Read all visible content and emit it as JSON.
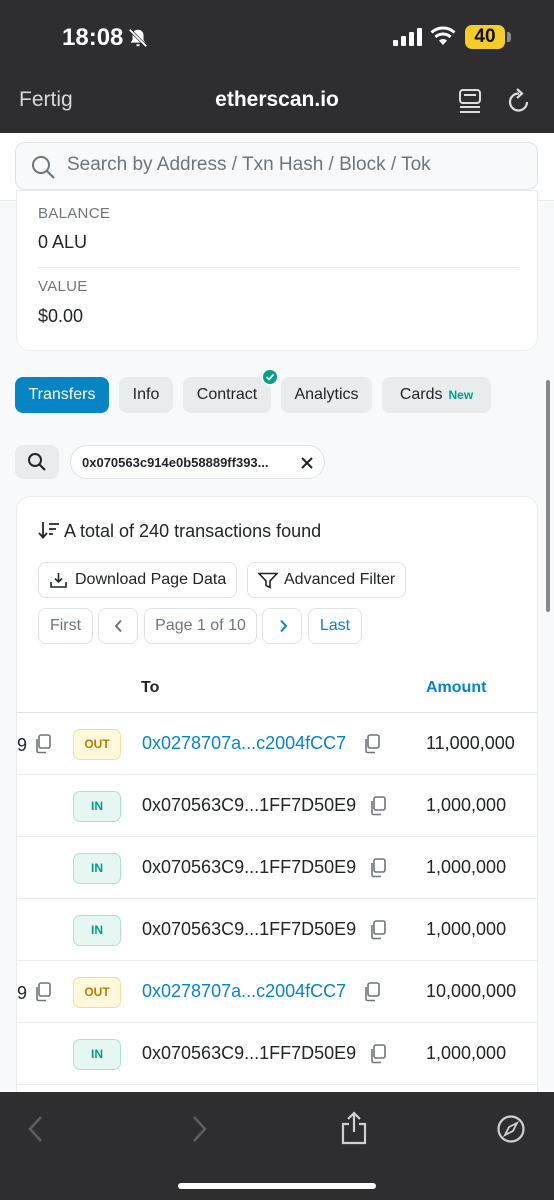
{
  "status_bar": {
    "time": "18:08",
    "battery": "40"
  },
  "browser": {
    "done_label": "Fertig",
    "url": "etherscan.io"
  },
  "search": {
    "placeholder": "Search by Address / Txn Hash / Block / Tok"
  },
  "overview": {
    "balance_label": "BALANCE",
    "balance_value": "0 ALU",
    "value_label": "VALUE",
    "value_value": "$0.00"
  },
  "tabs": [
    {
      "label": "Transfers",
      "active": true
    },
    {
      "label": "Info"
    },
    {
      "label": "Contract"
    },
    {
      "label": "Analytics"
    },
    {
      "label": "Cards",
      "badge": "New"
    }
  ],
  "filter": {
    "chip_text": "0x070563c914e0b58889ff393..."
  },
  "transactions": {
    "summary": "A total of 240 transactions found",
    "download_label": "Download Page Data",
    "advanced_filter_label": "Advanced Filter",
    "pagination": {
      "first": "First",
      "page": "Page 1 of 10",
      "last": "Last"
    },
    "columns": {
      "to": "To",
      "amount": "Amount"
    },
    "rows": [
      {
        "direction": "OUT",
        "to": "0x0278707a...c2004fCC7",
        "amount": "11,000,000"
      },
      {
        "direction": "IN",
        "to": "0x070563C9...1FF7D50E9",
        "amount": "1,000,000"
      },
      {
        "direction": "IN",
        "to": "0x070563C9...1FF7D50E9",
        "amount": "1,000,000"
      },
      {
        "direction": "IN",
        "to": "0x070563C9...1FF7D50E9",
        "amount": "1,000,000"
      },
      {
        "direction": "OUT",
        "to": "0x0278707a...c2004fCC7",
        "amount": "10,000,000"
      },
      {
        "direction": "IN",
        "to": "0x070563C9...1FF7D50E9",
        "amount": "1,000,000"
      }
    ],
    "row_cut_glyph": "9"
  },
  "colors": {
    "accent": "#0784c3",
    "in_green": "#00a186",
    "out_amber": "#b47d00",
    "chrome": "#2e2e30"
  }
}
